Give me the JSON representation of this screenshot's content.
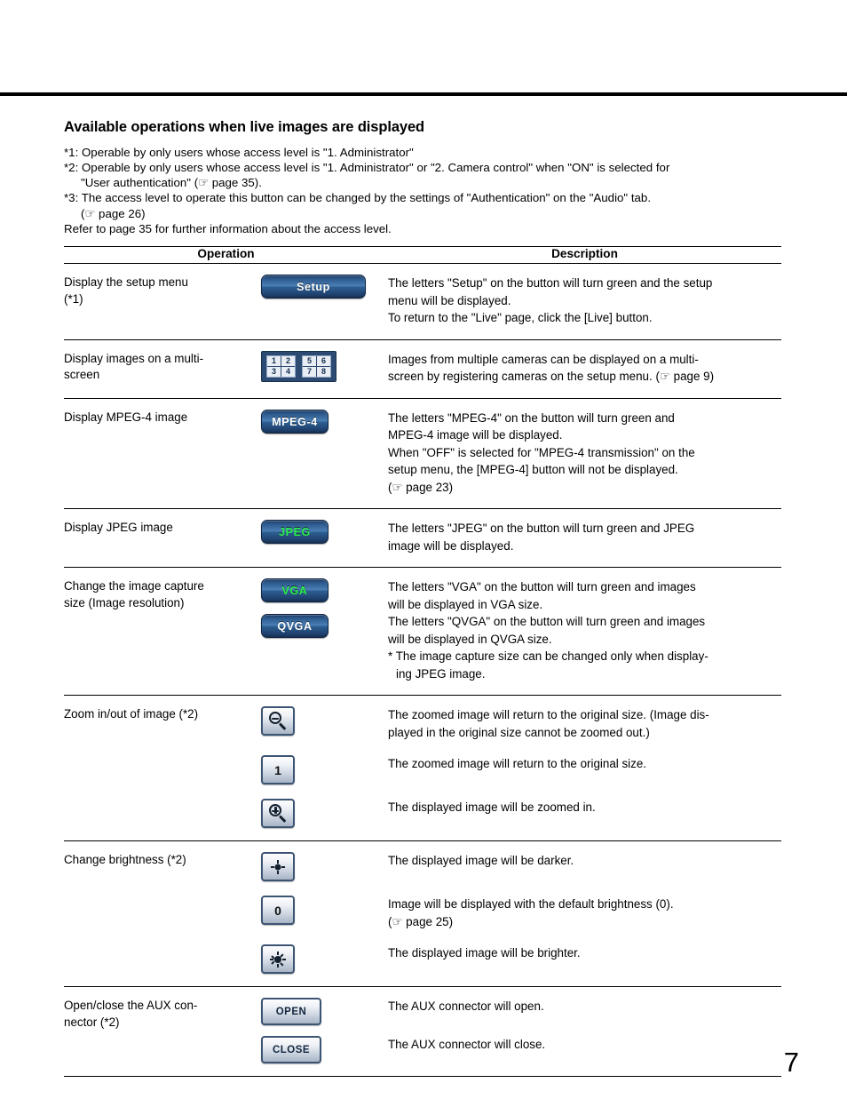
{
  "document": {
    "section_title": "Available operations when live images are displayed",
    "page_number": "7",
    "footnotes": [
      "*1: Operable by only users whose access level is \"1. Administrator\"",
      "*2: Operable by only users whose access level is \"1. Administrator\" or \"2. Camera control\" when \"ON\" is selected for",
      "\"User authentication\" (☞ page 35).",
      "*3: The access level to operate this button can be changed by the settings of \"Authentication\" on the \"Audio\" tab.",
      "(☞ page 26)",
      "Refer to page 35 for further information about the access level."
    ]
  },
  "table": {
    "headers": {
      "operation": "Operation",
      "description": "Description"
    },
    "rows": [
      {
        "operation": "Display the setup menu\n(*1)",
        "operation_line1": "Display the setup menu",
        "operation_line2": "(*1)",
        "button": {
          "type": "blue",
          "label": "Setup",
          "text_color": "#ffffff",
          "width": "wide"
        },
        "description": [
          "The letters \"Setup\" on the button will turn green and the setup",
          "menu will be displayed.",
          "To return to the \"Live\" page, click the [Live] button."
        ]
      },
      {
        "operation_line1": "Display images on a multi-",
        "operation_line2": "screen",
        "button": {
          "type": "multiscreen",
          "cells_left": [
            "1",
            "2",
            "3",
            "4"
          ],
          "cells_right": [
            "5",
            "6",
            "7",
            "8"
          ]
        },
        "description": [
          "Images from multiple cameras can be displayed on a multi-",
          "screen by registering cameras on the setup menu. (☞ page 9)"
        ]
      },
      {
        "operation_line1": "Display MPEG-4 image",
        "operation_line2": "",
        "button": {
          "type": "blue",
          "label": "MPEG-4",
          "text_color": "#ffffff",
          "width": "small"
        },
        "description": [
          "The letters \"MPEG-4\" on the button will turn green and",
          "MPEG-4 image will be displayed.",
          "When \"OFF\" is selected for \"MPEG-4 transmission\" on the",
          "setup menu, the [MPEG-4] button will not be displayed.",
          "(☞ page 23)"
        ]
      },
      {
        "operation_line1": "Display JPEG image",
        "operation_line2": "",
        "button": {
          "type": "blue",
          "label": "JPEG",
          "text_color": "#2bf04b",
          "width": "small"
        },
        "description": [
          "The letters \"JPEG\" on the button will turn green and JPEG",
          "image will be displayed."
        ]
      },
      {
        "operation_line1": "Change the image capture",
        "operation_line2": "size (Image resolution)",
        "buttons": [
          {
            "type": "blue",
            "label": "VGA",
            "text_color": "#2bf04b",
            "width": "small"
          },
          {
            "type": "blue",
            "label": "QVGA",
            "text_color": "#ffffff",
            "width": "small"
          }
        ],
        "description": [
          "The letters \"VGA\" on the button will turn green and images",
          "will be displayed in VGA size.",
          "The letters \"QVGA\" on the button will turn green and images",
          "will be displayed in QVGA size.",
          "* The image capture size can be changed only when display-",
          "ing JPEG image."
        ]
      },
      {
        "operation_line1": "Zoom in/out of image (*2)",
        "operation_line2": "",
        "pairs": [
          {
            "button": {
              "type": "silver",
              "icon": "magnifier-minus-icon"
            },
            "description": [
              "The zoomed image will return to the original size. (Image dis-",
              "played in the original size cannot be zoomed out.)"
            ]
          },
          {
            "button": {
              "type": "silver",
              "label": "1"
            },
            "description": [
              "The zoomed image will return to the original size."
            ]
          },
          {
            "button": {
              "type": "silver",
              "icon": "magnifier-plus-icon"
            },
            "description": [
              "The displayed image will be zoomed in."
            ]
          }
        ]
      },
      {
        "operation_line1": "Change brightness (*2)",
        "operation_line2": "",
        "pairs": [
          {
            "button": {
              "type": "silver",
              "icon": "brightness-down-icon"
            },
            "description": [
              "The displayed image will be darker."
            ]
          },
          {
            "button": {
              "type": "silver",
              "label": "0"
            },
            "description": [
              "Image will be displayed with the default brightness (0).",
              "(☞ page 25)"
            ]
          },
          {
            "button": {
              "type": "silver",
              "icon": "brightness-up-icon"
            },
            "description": [
              "The displayed image will be brighter."
            ]
          }
        ]
      },
      {
        "operation_line1": "Open/close the AUX con-",
        "operation_line2": "nector (*2)",
        "pairs": [
          {
            "button": {
              "type": "silver-wide",
              "label": "OPEN"
            },
            "description": [
              "The AUX connector will open."
            ]
          },
          {
            "button": {
              "type": "silver-wide",
              "label": "CLOSE"
            },
            "description": [
              "The AUX connector will close."
            ]
          }
        ]
      }
    ]
  }
}
